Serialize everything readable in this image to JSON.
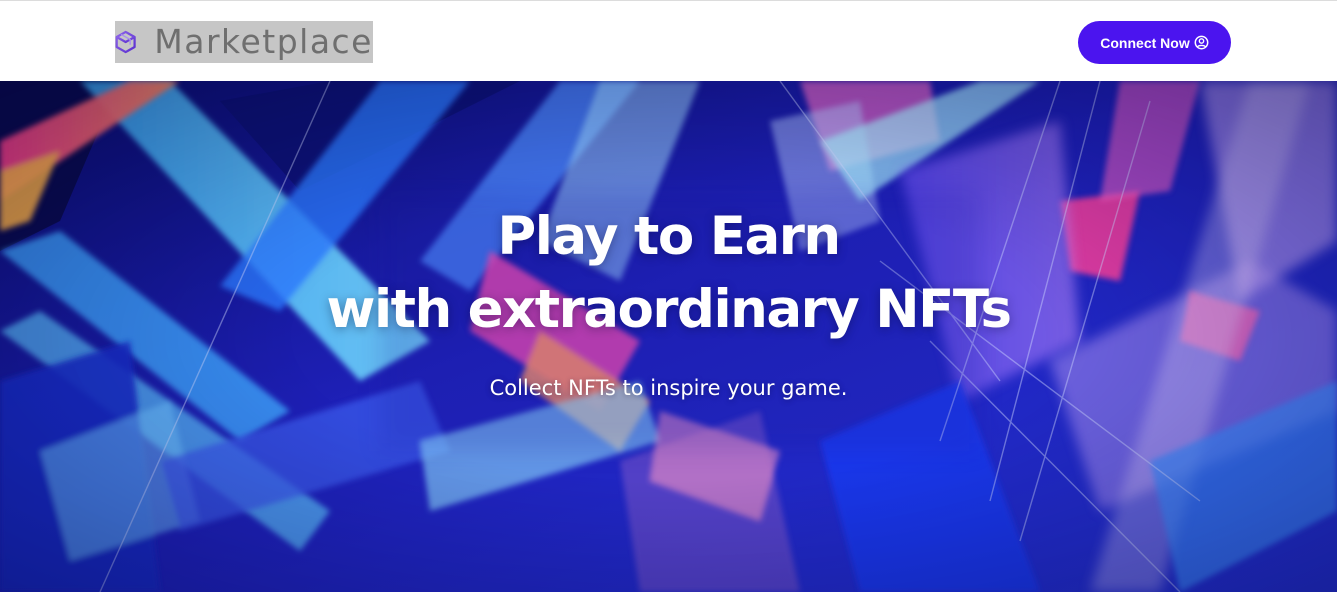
{
  "header": {
    "logo_text": "Marketplace",
    "logo_icon": "cube-icon",
    "connect_label": "Connect Now",
    "connect_icon": "user-circle-icon"
  },
  "hero": {
    "title_line1": "Play to Earn",
    "title_line2": "with extraordinary NFTs",
    "subtitle": "Collect NFTs to inspire your game."
  },
  "colors": {
    "accent": "#4b14ef",
    "logo_bg": "#c6c6c6",
    "logo_text": "#6f6f6f",
    "hero_base": "#1d17a8"
  }
}
